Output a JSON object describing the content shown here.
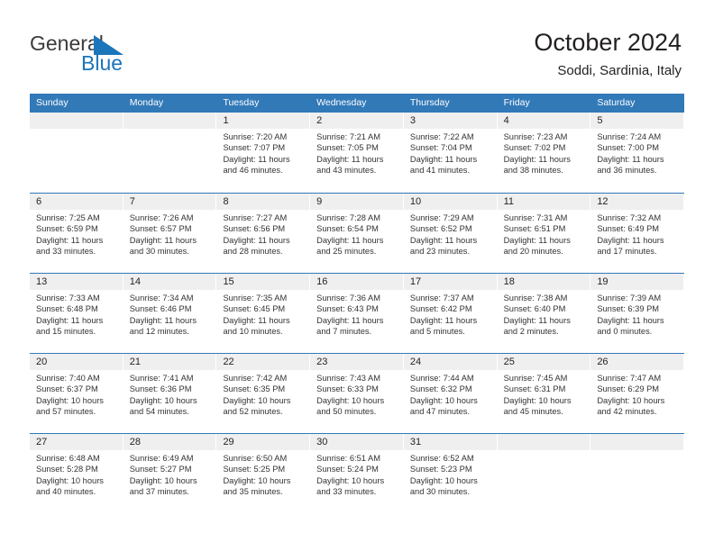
{
  "brand": {
    "name_part1": "General",
    "name_part2": "Blue",
    "triangle_color": "#1b75bb",
    "text_color": "#3b3b3b"
  },
  "header": {
    "title": "October 2024",
    "subtitle": "Soddi, Sardinia, Italy"
  },
  "theme": {
    "header_blue": "#3279b8",
    "day_number_band": "#efefef",
    "body_text": "#333333"
  },
  "calendar": {
    "weekday_headers": [
      "Sunday",
      "Monday",
      "Tuesday",
      "Wednesday",
      "Thursday",
      "Friday",
      "Saturday"
    ],
    "weeks": [
      [
        {
          "day": "",
          "sunrise": "",
          "sunset": "",
          "daylight_line1": "",
          "daylight_line2": ""
        },
        {
          "day": "",
          "sunrise": "",
          "sunset": "",
          "daylight_line1": "",
          "daylight_line2": ""
        },
        {
          "day": "1",
          "sunrise": "Sunrise: 7:20 AM",
          "sunset": "Sunset: 7:07 PM",
          "daylight_line1": "Daylight: 11 hours",
          "daylight_line2": "and 46 minutes."
        },
        {
          "day": "2",
          "sunrise": "Sunrise: 7:21 AM",
          "sunset": "Sunset: 7:05 PM",
          "daylight_line1": "Daylight: 11 hours",
          "daylight_line2": "and 43 minutes."
        },
        {
          "day": "3",
          "sunrise": "Sunrise: 7:22 AM",
          "sunset": "Sunset: 7:04 PM",
          "daylight_line1": "Daylight: 11 hours",
          "daylight_line2": "and 41 minutes."
        },
        {
          "day": "4",
          "sunrise": "Sunrise: 7:23 AM",
          "sunset": "Sunset: 7:02 PM",
          "daylight_line1": "Daylight: 11 hours",
          "daylight_line2": "and 38 minutes."
        },
        {
          "day": "5",
          "sunrise": "Sunrise: 7:24 AM",
          "sunset": "Sunset: 7:00 PM",
          "daylight_line1": "Daylight: 11 hours",
          "daylight_line2": "and 36 minutes."
        }
      ],
      [
        {
          "day": "6",
          "sunrise": "Sunrise: 7:25 AM",
          "sunset": "Sunset: 6:59 PM",
          "daylight_line1": "Daylight: 11 hours",
          "daylight_line2": "and 33 minutes."
        },
        {
          "day": "7",
          "sunrise": "Sunrise: 7:26 AM",
          "sunset": "Sunset: 6:57 PM",
          "daylight_line1": "Daylight: 11 hours",
          "daylight_line2": "and 30 minutes."
        },
        {
          "day": "8",
          "sunrise": "Sunrise: 7:27 AM",
          "sunset": "Sunset: 6:56 PM",
          "daylight_line1": "Daylight: 11 hours",
          "daylight_line2": "and 28 minutes."
        },
        {
          "day": "9",
          "sunrise": "Sunrise: 7:28 AM",
          "sunset": "Sunset: 6:54 PM",
          "daylight_line1": "Daylight: 11 hours",
          "daylight_line2": "and 25 minutes."
        },
        {
          "day": "10",
          "sunrise": "Sunrise: 7:29 AM",
          "sunset": "Sunset: 6:52 PM",
          "daylight_line1": "Daylight: 11 hours",
          "daylight_line2": "and 23 minutes."
        },
        {
          "day": "11",
          "sunrise": "Sunrise: 7:31 AM",
          "sunset": "Sunset: 6:51 PM",
          "daylight_line1": "Daylight: 11 hours",
          "daylight_line2": "and 20 minutes."
        },
        {
          "day": "12",
          "sunrise": "Sunrise: 7:32 AM",
          "sunset": "Sunset: 6:49 PM",
          "daylight_line1": "Daylight: 11 hours",
          "daylight_line2": "and 17 minutes."
        }
      ],
      [
        {
          "day": "13",
          "sunrise": "Sunrise: 7:33 AM",
          "sunset": "Sunset: 6:48 PM",
          "daylight_line1": "Daylight: 11 hours",
          "daylight_line2": "and 15 minutes."
        },
        {
          "day": "14",
          "sunrise": "Sunrise: 7:34 AM",
          "sunset": "Sunset: 6:46 PM",
          "daylight_line1": "Daylight: 11 hours",
          "daylight_line2": "and 12 minutes."
        },
        {
          "day": "15",
          "sunrise": "Sunrise: 7:35 AM",
          "sunset": "Sunset: 6:45 PM",
          "daylight_line1": "Daylight: 11 hours",
          "daylight_line2": "and 10 minutes."
        },
        {
          "day": "16",
          "sunrise": "Sunrise: 7:36 AM",
          "sunset": "Sunset: 6:43 PM",
          "daylight_line1": "Daylight: 11 hours",
          "daylight_line2": "and 7 minutes."
        },
        {
          "day": "17",
          "sunrise": "Sunrise: 7:37 AM",
          "sunset": "Sunset: 6:42 PM",
          "daylight_line1": "Daylight: 11 hours",
          "daylight_line2": "and 5 minutes."
        },
        {
          "day": "18",
          "sunrise": "Sunrise: 7:38 AM",
          "sunset": "Sunset: 6:40 PM",
          "daylight_line1": "Daylight: 11 hours",
          "daylight_line2": "and 2 minutes."
        },
        {
          "day": "19",
          "sunrise": "Sunrise: 7:39 AM",
          "sunset": "Sunset: 6:39 PM",
          "daylight_line1": "Daylight: 11 hours",
          "daylight_line2": "and 0 minutes."
        }
      ],
      [
        {
          "day": "20",
          "sunrise": "Sunrise: 7:40 AM",
          "sunset": "Sunset: 6:37 PM",
          "daylight_line1": "Daylight: 10 hours",
          "daylight_line2": "and 57 minutes."
        },
        {
          "day": "21",
          "sunrise": "Sunrise: 7:41 AM",
          "sunset": "Sunset: 6:36 PM",
          "daylight_line1": "Daylight: 10 hours",
          "daylight_line2": "and 54 minutes."
        },
        {
          "day": "22",
          "sunrise": "Sunrise: 7:42 AM",
          "sunset": "Sunset: 6:35 PM",
          "daylight_line1": "Daylight: 10 hours",
          "daylight_line2": "and 52 minutes."
        },
        {
          "day": "23",
          "sunrise": "Sunrise: 7:43 AM",
          "sunset": "Sunset: 6:33 PM",
          "daylight_line1": "Daylight: 10 hours",
          "daylight_line2": "and 50 minutes."
        },
        {
          "day": "24",
          "sunrise": "Sunrise: 7:44 AM",
          "sunset": "Sunset: 6:32 PM",
          "daylight_line1": "Daylight: 10 hours",
          "daylight_line2": "and 47 minutes."
        },
        {
          "day": "25",
          "sunrise": "Sunrise: 7:45 AM",
          "sunset": "Sunset: 6:31 PM",
          "daylight_line1": "Daylight: 10 hours",
          "daylight_line2": "and 45 minutes."
        },
        {
          "day": "26",
          "sunrise": "Sunrise: 7:47 AM",
          "sunset": "Sunset: 6:29 PM",
          "daylight_line1": "Daylight: 10 hours",
          "daylight_line2": "and 42 minutes."
        }
      ],
      [
        {
          "day": "27",
          "sunrise": "Sunrise: 6:48 AM",
          "sunset": "Sunset: 5:28 PM",
          "daylight_line1": "Daylight: 10 hours",
          "daylight_line2": "and 40 minutes."
        },
        {
          "day": "28",
          "sunrise": "Sunrise: 6:49 AM",
          "sunset": "Sunset: 5:27 PM",
          "daylight_line1": "Daylight: 10 hours",
          "daylight_line2": "and 37 minutes."
        },
        {
          "day": "29",
          "sunrise": "Sunrise: 6:50 AM",
          "sunset": "Sunset: 5:25 PM",
          "daylight_line1": "Daylight: 10 hours",
          "daylight_line2": "and 35 minutes."
        },
        {
          "day": "30",
          "sunrise": "Sunrise: 6:51 AM",
          "sunset": "Sunset: 5:24 PM",
          "daylight_line1": "Daylight: 10 hours",
          "daylight_line2": "and 33 minutes."
        },
        {
          "day": "31",
          "sunrise": "Sunrise: 6:52 AM",
          "sunset": "Sunset: 5:23 PM",
          "daylight_line1": "Daylight: 10 hours",
          "daylight_line2": "and 30 minutes."
        },
        {
          "day": "",
          "sunrise": "",
          "sunset": "",
          "daylight_line1": "",
          "daylight_line2": ""
        },
        {
          "day": "",
          "sunrise": "",
          "sunset": "",
          "daylight_line1": "",
          "daylight_line2": ""
        }
      ]
    ]
  }
}
